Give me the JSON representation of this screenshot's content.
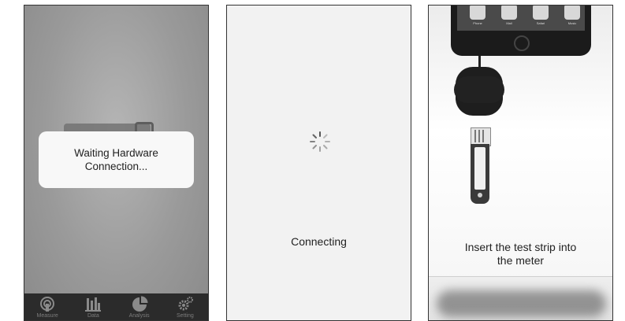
{
  "screen1": {
    "dialog_text": "Waiting Hardware\nConnection...",
    "tabs": [
      {
        "label": "Measure",
        "icon": "measure-icon"
      },
      {
        "label": "Data",
        "icon": "bar-chart-icon"
      },
      {
        "label": "Analysis",
        "icon": "pie-chart-icon"
      },
      {
        "label": "Setting",
        "icon": "gears-icon"
      }
    ]
  },
  "screen2": {
    "status_text": "Connecting"
  },
  "screen3": {
    "phone_apps": [
      "Phone",
      "Mail",
      "Safari",
      "Music"
    ],
    "instruction_text": "Insert the test strip into\nthe meter"
  }
}
